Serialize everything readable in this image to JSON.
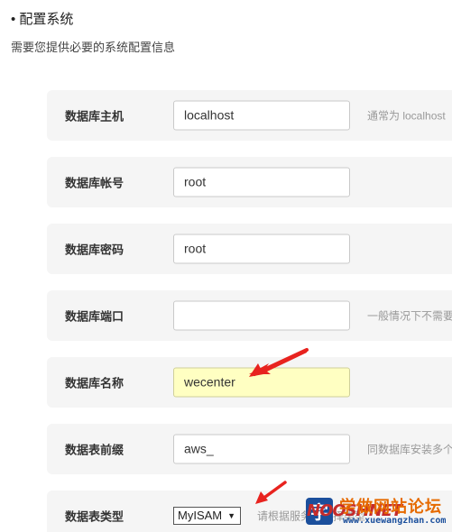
{
  "section": {
    "title": "• 配置系统",
    "description": "需要您提供必要的系统配置信息"
  },
  "form": {
    "db_host": {
      "label": "数据库主机",
      "value": "localhost",
      "hint": "通常为 localhost"
    },
    "db_user": {
      "label": "数据库帐号",
      "value": "root"
    },
    "db_pass": {
      "label": "数据库密码",
      "value": "root"
    },
    "db_port": {
      "label": "数据库端口",
      "value": "",
      "hint": "一般情况下不需要"
    },
    "db_name": {
      "label": "数据库名称",
      "value": "wecenter"
    },
    "db_prefix": {
      "label": "数据表前缀",
      "value": "aws_",
      "hint": "同数据库安装多个"
    },
    "db_engine": {
      "label": "数据表类型",
      "selected": "MyISAM",
      "hint": "请根据服务器选择类型"
    }
  },
  "watermark": {
    "brand": "学做网站论坛",
    "overlay": "NOOSHNET",
    "url": "www.xuewangzhan.com"
  },
  "colors": {
    "row_bg": "#f5f5f5",
    "highlight": "#ffffc2",
    "arrow": "#e8231f",
    "watermark_orange": "#e66a00",
    "watermark_blue": "#1b4f9c"
  }
}
